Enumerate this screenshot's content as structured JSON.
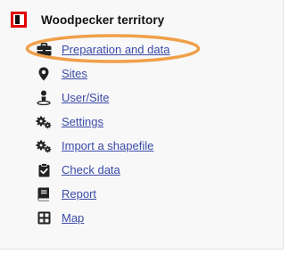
{
  "header": {
    "title": "Woodpecker territory",
    "icon": "app-logo-icon"
  },
  "menu": {
    "items": [
      {
        "label": "Preparation and data",
        "icon": "briefcase-icon"
      },
      {
        "label": "Sites",
        "icon": "map-marker-icon"
      },
      {
        "label": "User/Site",
        "icon": "user-pin-icon"
      },
      {
        "label": "Settings",
        "icon": "cogs-icon"
      },
      {
        "label": "Import a shapefile",
        "icon": "cogs-icon"
      },
      {
        "label": "Check data",
        "icon": "clipboard-check-icon"
      },
      {
        "label": "Report",
        "icon": "book-icon"
      },
      {
        "label": "Map",
        "icon": "grid-icon"
      }
    ]
  },
  "colors": {
    "accent_red": "#e00000",
    "link": "#3a4aa8",
    "highlight_ring": "#f0a04a"
  }
}
